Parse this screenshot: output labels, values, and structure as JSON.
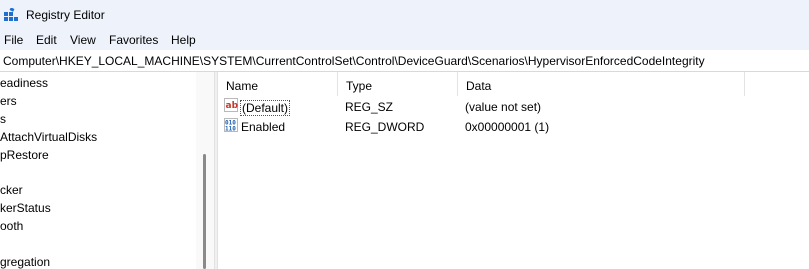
{
  "window": {
    "title": "Registry Editor"
  },
  "menu": [
    "File",
    "Edit",
    "View",
    "Favorites",
    "Help"
  ],
  "address": "Computer\\HKEY_LOCAL_MACHINE\\SYSTEM\\CurrentControlSet\\Control\\DeviceGuard\\Scenarios\\HypervisorEnforcedCodeIntegrity",
  "tree": {
    "items": [
      "eadiness",
      "ers",
      "s",
      "AttachVirtualDisks",
      "pRestore",
      "",
      "cker",
      "kerStatus",
      "ooth",
      "",
      "gregation"
    ]
  },
  "list": {
    "columns": [
      "Name",
      "Type",
      "Data"
    ],
    "rows": [
      {
        "icon": "string-value-icon",
        "name": "(Default)",
        "type": "REG_SZ",
        "data": "(value not set)"
      },
      {
        "icon": "binary-value-icon",
        "name": "Enabled",
        "type": "REG_DWORD",
        "data": "0x00000001 (1)"
      }
    ]
  },
  "colors": {
    "chrome": "#eef3fb",
    "string_icon": "#c0392b",
    "binary_icon": "#1f5fb0"
  }
}
